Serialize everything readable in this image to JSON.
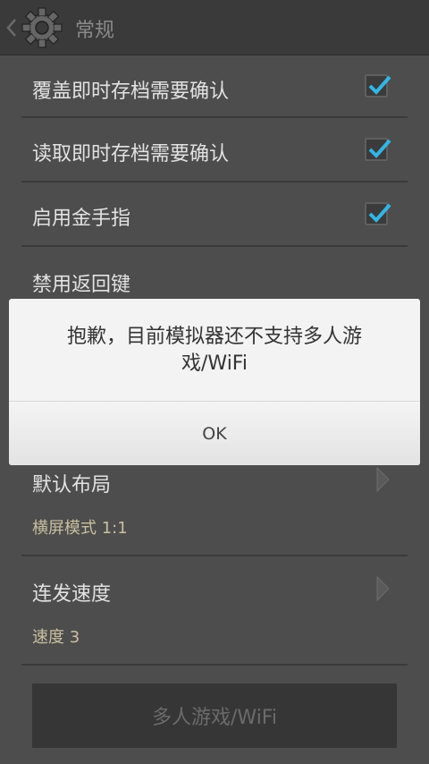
{
  "actionbar": {
    "title": "常规"
  },
  "settings": [
    {
      "label": "覆盖即时存档需要确认",
      "checked": true
    },
    {
      "label": "读取即时存档需要确认",
      "checked": true
    },
    {
      "label": "启用金手指",
      "checked": true
    },
    {
      "label": "禁用返回键"
    }
  ],
  "layout_item": {
    "label": "默认布局",
    "value": "横屏模式 1:1"
  },
  "speed_item": {
    "label": "连发速度",
    "value": "速度 3"
  },
  "multiplayer_button": {
    "label": "多人游戏/WiFi"
  },
  "dialog": {
    "message": "抱歉，目前模拟器还不支持多人游戏/WiFi",
    "ok_label": "OK"
  },
  "colors": {
    "accent": "#33b5e5",
    "summary": "#c9bf9f"
  }
}
